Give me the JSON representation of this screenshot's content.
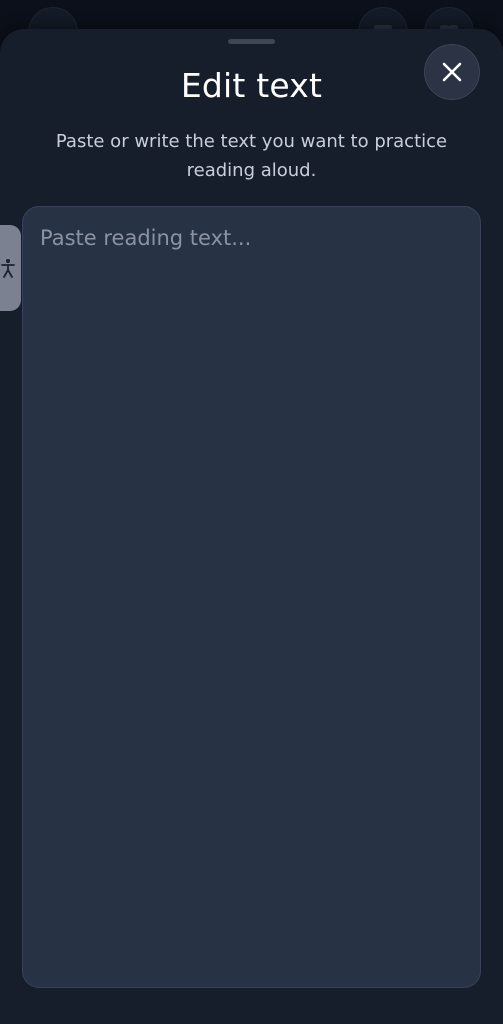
{
  "sheet": {
    "title": "Edit text",
    "subtitle": "Paste or write the text you want to practice reading aloud.",
    "close_icon": "close-icon"
  },
  "editor": {
    "placeholder": "Paste reading text...",
    "value": ""
  },
  "accessibility": {
    "icon": "accessibility-person-icon"
  },
  "colors": {
    "sheet_background": "#161d2b",
    "textarea_background": "#283245",
    "title": "#ffffff",
    "subtitle": "#c9cfda",
    "placeholder": "#8b93a3"
  }
}
